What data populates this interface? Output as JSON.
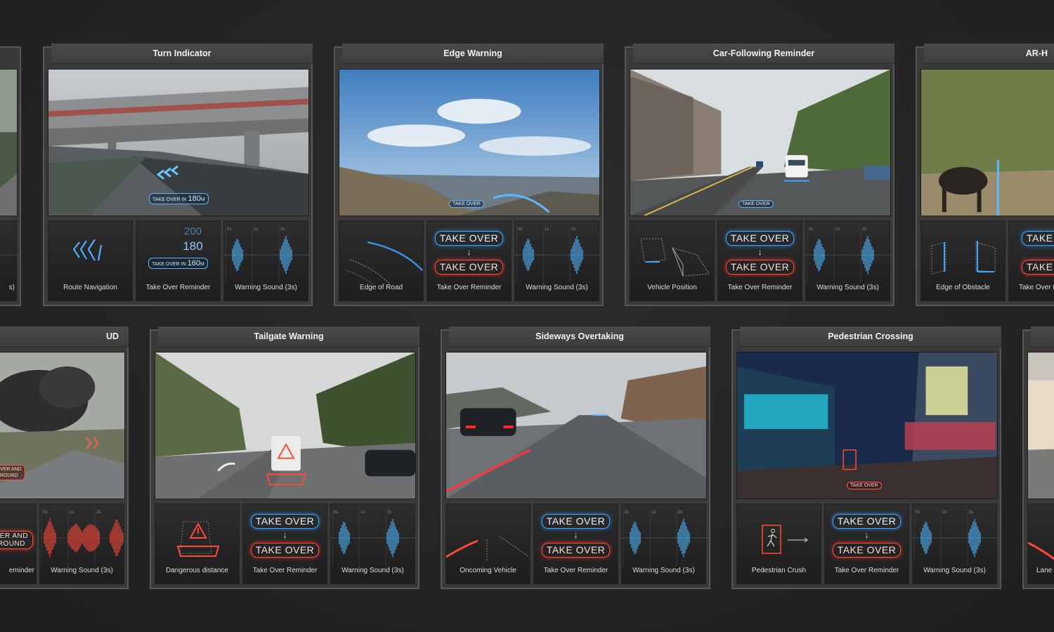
{
  "cards": {
    "turn": {
      "title": "Turn Indicator",
      "hud_tag_prefix": "TAKE OVER IN",
      "hud_tag_value": "180",
      "hud_tag_unit": "M",
      "panels": [
        "Route Navigation",
        "Take Over Reminder",
        "Warning Sound (3s)"
      ],
      "countdown": [
        "200",
        "180"
      ],
      "countdown_prefix": "TAKE OVER IN",
      "countdown_value": "160",
      "countdown_unit": "M"
    },
    "edge": {
      "title": "Edge Warning",
      "hud_tag": "TAKE OVER",
      "panels": [
        "Edge of Road",
        "Take Over Reminder",
        "Warning Sound (3s)"
      ]
    },
    "carfollow": {
      "title": "Car-Following Reminder",
      "hud_tag": "TAKE OVER",
      "panels": [
        "Vehicle Position",
        "Take Over Reminder",
        "Warning Sound (3s)"
      ]
    },
    "ar": {
      "title": "AR-H",
      "panels": [
        "Edge of Obstacle",
        "TAKE O",
        "TAKE O",
        "Take Over R"
      ]
    },
    "ud": {
      "title": "UD",
      "hud_tag_a": "VER AND",
      "hud_tag_b": "ROUND",
      "panels": [
        "s)",
        "VER AND",
        "ROUND",
        "eminder",
        "Warning Sound (3s)"
      ]
    },
    "tailgate": {
      "title": "Tailgate Warning",
      "panels": [
        "Dangerous distance",
        "Take Over Reminder",
        "Warning Sound (3s)"
      ]
    },
    "sideways": {
      "title": "Sideways Overtaking",
      "panels": [
        "Oncoming Vehicle",
        "Take Over Reminder",
        "Warning Sound (3s)"
      ]
    },
    "pedestrian": {
      "title": "Pedestrian Crossing",
      "hud_tag": "TAKE OVER",
      "panels": [
        "Pedestrian Crush",
        "Take Over Reminder",
        "Warning Sound (3s)"
      ]
    },
    "lane": {
      "panels": [
        "Lane C"
      ]
    }
  },
  "common": {
    "take_over": "TAKE OVER",
    "arrow": "↓",
    "ticks": [
      "0s",
      "1s",
      "2s"
    ]
  },
  "colors": {
    "accent_blue": "#3ea4ff",
    "accent_red": "#ff4a3a",
    "background": "#262626",
    "card": "#3a3a3a"
  }
}
